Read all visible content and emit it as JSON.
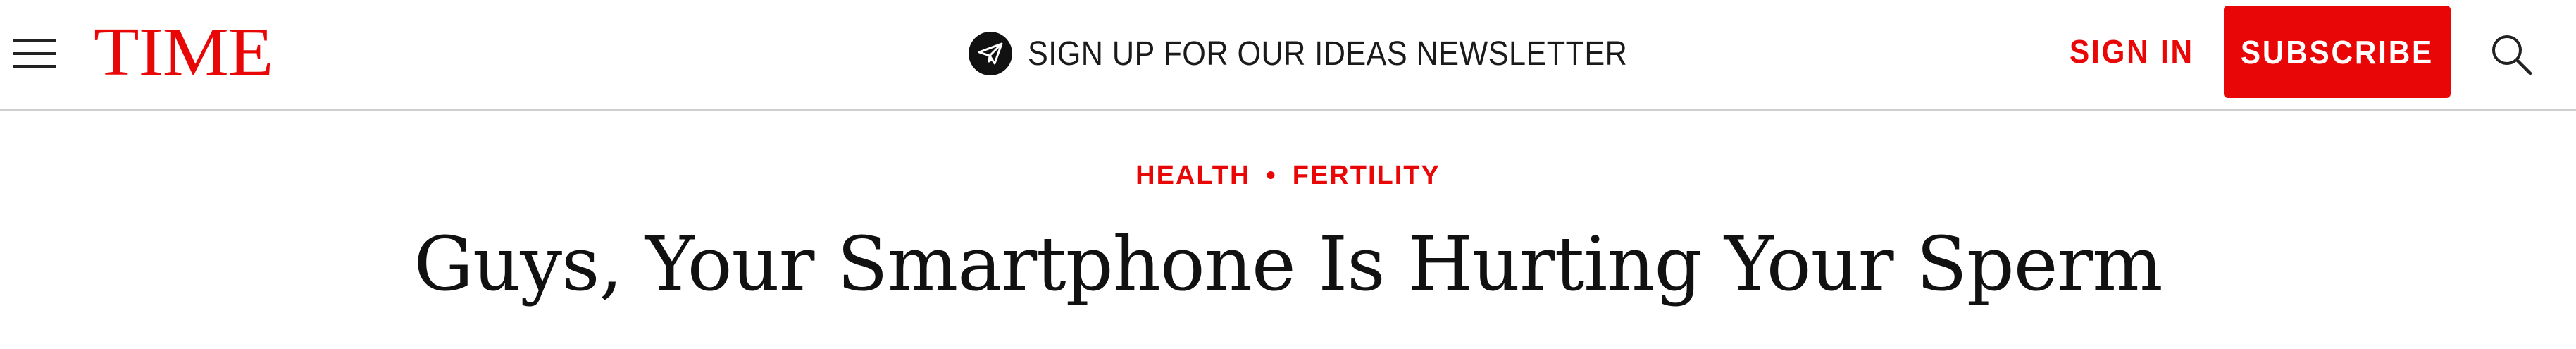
{
  "header": {
    "logo_text": "TIME",
    "newsletter_label": "SIGN UP FOR OUR IDEAS NEWSLETTER",
    "sign_in_label": "SIGN IN",
    "subscribe_label": "SUBSCRIBE",
    "icons": {
      "menu": "hamburger-menu-icon",
      "newsletter": "paper-plane-icon",
      "search": "search-icon"
    }
  },
  "article": {
    "kicker": {
      "section": "HEALTH",
      "separator": "•",
      "topic": "FERTILITY"
    },
    "headline": "Guys, Your Smartphone Is Hurting Your Sperm"
  },
  "colors": {
    "brand_red": "#e90606",
    "text_dark": "#111111",
    "divider": "#cfcfcf"
  }
}
